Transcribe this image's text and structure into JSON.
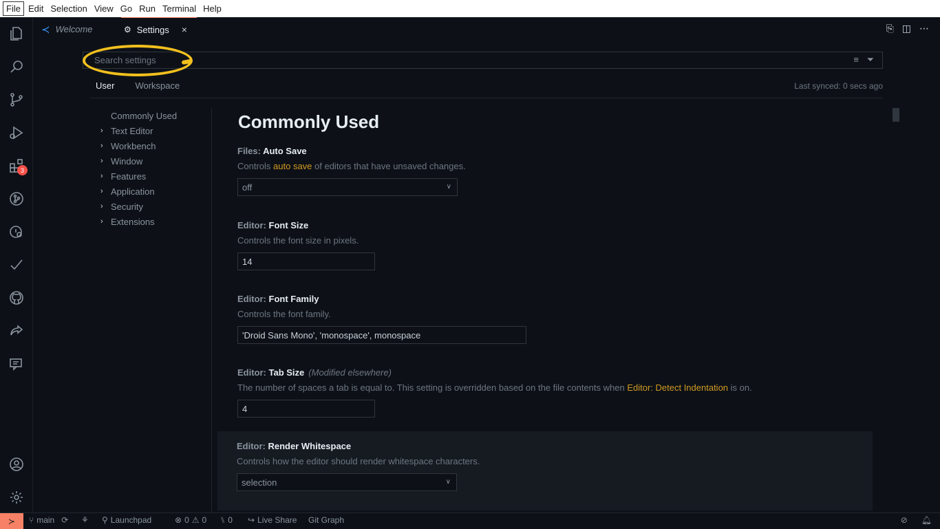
{
  "menu": [
    "File",
    "Edit",
    "Selection",
    "View",
    "Go",
    "Run",
    "Terminal",
    "Help"
  ],
  "activity": {
    "icons": [
      "explorer-icon",
      "search-icon",
      "source-control-icon",
      "run-debug-icon",
      "extensions-icon",
      "git-graph-icon",
      "remote-explorer-icon",
      "testing-icon",
      "github-icon",
      "live-share-icon",
      "comments-icon"
    ],
    "extensions_badge": "3",
    "bottom_icons": [
      "account-icon",
      "manage-gear-icon"
    ]
  },
  "tabs": {
    "welcome": "Welcome",
    "settings": "Settings",
    "close": "×"
  },
  "search": {
    "placeholder": "Search settings"
  },
  "scope": {
    "user": "User",
    "workspace": "Workspace",
    "synced": "Last synced: 0 secs ago"
  },
  "toc": {
    "top": "Commonly Used",
    "items": [
      "Text Editor",
      "Workbench",
      "Window",
      "Features",
      "Application",
      "Security",
      "Extensions"
    ]
  },
  "content": {
    "title": "Commonly Used",
    "autosave": {
      "category": "Files: ",
      "name": "Auto Save",
      "desc_pre": "Controls ",
      "desc_link": "auto save",
      "desc_post": " of editors that have unsaved changes.",
      "value": "off"
    },
    "fontsize": {
      "category": "Editor: ",
      "name": "Font Size",
      "desc": "Controls the font size in pixels.",
      "value": "14"
    },
    "fontfamily": {
      "category": "Editor: ",
      "name": "Font Family",
      "desc": "Controls the font family.",
      "value": "'Droid Sans Mono', 'monospace', monospace"
    },
    "tabsize": {
      "category": "Editor: ",
      "name": "Tab Size",
      "modified": "(Modified elsewhere)",
      "desc_pre": "The number of spaces a tab is equal to. This setting is overridden based on the file contents when ",
      "desc_link": "Editor: Detect Indentation",
      "desc_post": " is on.",
      "value": "4"
    },
    "whitespace": {
      "category": "Editor: ",
      "name": "Render Whitespace",
      "desc": "Controls how the editor should render whitespace characters.",
      "value": "selection"
    }
  },
  "status": {
    "branch": "main",
    "launchpad": "Launchpad",
    "errors": "0",
    "warnings": "0",
    "ports": "0",
    "liveshare": "Live Share",
    "gitgraph": "Git Graph"
  },
  "colors": {
    "accent": "#f78166",
    "highlight": "#f2c01e",
    "link": "#d29922"
  }
}
